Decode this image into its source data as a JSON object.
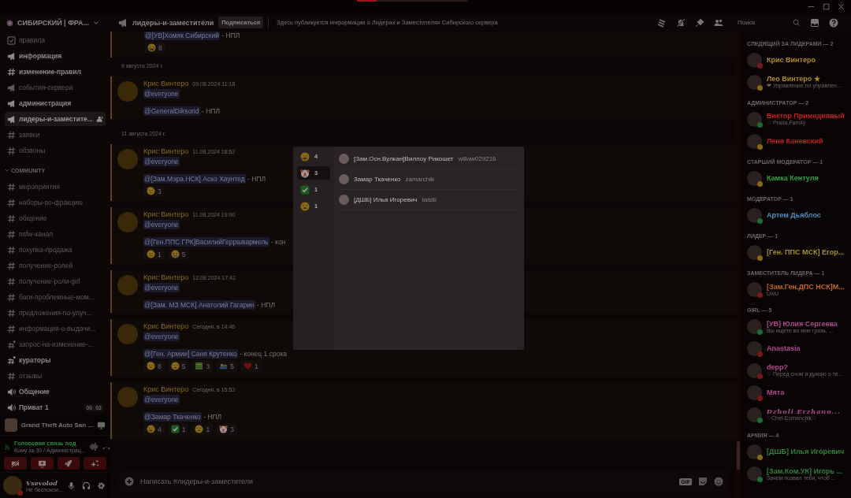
{
  "update_bar": {
    "level": 0.18
  },
  "server": {
    "name": "СИБИРСКИЙ | ФРА..."
  },
  "channels": [
    {
      "kind": "rules",
      "name": "правила",
      "unread": false,
      "selected": false
    },
    {
      "kind": "announce",
      "name": "информация",
      "unread": true,
      "selected": false
    },
    {
      "kind": "text",
      "name": "изменение-правил",
      "unread": true,
      "selected": false
    },
    {
      "kind": "announce",
      "name": "события-сервера",
      "unread": false,
      "selected": false
    },
    {
      "kind": "announce",
      "name": "администрация",
      "unread": true,
      "selected": false
    },
    {
      "kind": "announce",
      "name": "лидеры-и-заместите...",
      "unread": true,
      "selected": true
    },
    {
      "kind": "text",
      "name": "заявки",
      "unread": false,
      "selected": false
    },
    {
      "kind": "text",
      "name": "обзвоны",
      "unread": false,
      "selected": false
    },
    {
      "kind": "category",
      "name": "COMMUNITY",
      "expanded": true
    },
    {
      "kind": "text",
      "name": "мероприятия",
      "unread": false,
      "selected": false
    },
    {
      "kind": "text",
      "name": "наборы-во-фракцию",
      "unread": false,
      "selected": false
    },
    {
      "kind": "text",
      "name": "общение",
      "unread": false,
      "selected": false
    },
    {
      "kind": "text",
      "name": "nsfw-канал",
      "unread": false,
      "selected": false
    },
    {
      "kind": "text",
      "name": "покупка-продажа",
      "unread": false,
      "selected": false
    },
    {
      "kind": "text",
      "name": "получение-ролей",
      "unread": false,
      "selected": false
    },
    {
      "kind": "text",
      "name": "получение-роли-girl",
      "unread": false,
      "selected": false
    },
    {
      "kind": "text",
      "name": "баги-проблемные-мом...",
      "unread": false,
      "selected": false
    },
    {
      "kind": "text",
      "name": "предложения-по-улуч...",
      "unread": false,
      "selected": false
    },
    {
      "kind": "text",
      "name": "информация-о-выдачи...",
      "unread": false,
      "selected": false
    },
    {
      "kind": "thread",
      "name": "запрос-на-изменение-...",
      "unread": false,
      "selected": false
    },
    {
      "kind": "thread",
      "name": "кураторы",
      "unread": true,
      "selected": false
    },
    {
      "kind": "text",
      "name": "отзывы",
      "unread": false,
      "selected": false
    },
    {
      "kind": "voice",
      "name": "Общение",
      "unread": true,
      "selected": false
    },
    {
      "kind": "voice",
      "name": "Приват 1",
      "unread": true,
      "selected": false,
      "counters": [
        "00",
        "02"
      ]
    }
  ],
  "activity": {
    "title": "Grand Theft Auto San ..."
  },
  "voice": {
    "status": "Голосовая связь под",
    "channel": "Кому за 30 / Администрац..."
  },
  "user": {
    "name": "Vsevolod",
    "status_text": "Не беспокои...",
    "kind": "dnd"
  },
  "header": {
    "channel": "лидеры-и-заместители",
    "subscribe": "Подписаться",
    "topic": "Здесь публикуется информация о Лидерах и Заместителях Сибирского сервера",
    "search": {
      "placeholder": "Поиск"
    }
  },
  "messages": [
    {
      "kind": "continuation",
      "lines": [
        {
          "mention": "@[УВ]Хомяк Сибирский",
          "text": " - НПЛ"
        }
      ],
      "reactions": [
        {
          "kind": "joy",
          "count": "8"
        }
      ]
    },
    {
      "kind": "divider",
      "text": "9 августа 2024 г."
    },
    {
      "kind": "message",
      "author": "Крис Винтеро",
      "time": "09.08.2024 11:18",
      "everyone": "@everyone",
      "lines": [
        {
          "mention": "@GeneralDiksond",
          "text": " - НПЛ"
        }
      ]
    },
    {
      "kind": "divider",
      "text": "11 августа 2024 г."
    },
    {
      "kind": "message",
      "author": "Крис Винтеро",
      "time": "11.08.2024 18:52",
      "everyone": "@everyone",
      "lines": [
        {
          "mention": "@[Зам.Мэра.НСК] Аско Хаунтед",
          "text": " - НПЛ"
        }
      ],
      "reactions": [
        {
          "kind": "salute",
          "count": "3"
        }
      ]
    },
    {
      "kind": "message",
      "author": "Крис Винтеро",
      "time": "11.08.2024 19:00",
      "everyone": "@everyone",
      "lines": [
        {
          "mention": "@[Ген.ППС ГРК]ВасилийГерршвармель",
          "text": " - кон"
        }
      ],
      "reactions": [
        {
          "kind": "sad",
          "count": "1"
        },
        {
          "kind": "cry",
          "count": "5"
        }
      ]
    },
    {
      "kind": "message",
      "author": "Крис Винтеро",
      "time": "12.08.2024 17:42",
      "everyone": "@everyone",
      "lines": [
        {
          "mention": "@[Зам. МЗ МСК] Анатолий Гагарин",
          "text": " - НПЛ"
        }
      ]
    },
    {
      "kind": "message",
      "author": "Крис Винтеро",
      "time": "Сегодня, в 14:46",
      "everyone": "@everyone",
      "lines": [
        {
          "mention": "@[Ген. Армии] Саня Крутенко",
          "text": " - конец 1 срока"
        }
      ],
      "reactions": [
        {
          "kind": "salute",
          "count": "8"
        },
        {
          "kind": "weary",
          "count": "5"
        },
        {
          "kind": "sticker",
          "count": "3"
        },
        {
          "kind": "sleep",
          "count": "5"
        },
        {
          "kind": "heart",
          "count": "1"
        }
      ]
    },
    {
      "kind": "message",
      "author": "Крис Винтеро",
      "time": "Сегодня, в 15:53",
      "everyone": "@everyone",
      "lines": [
        {
          "mention": "@Замар Ткаченко",
          "text": " - НПЛ"
        }
      ],
      "reactions": [
        {
          "kind": "rofl",
          "count": "4"
        },
        {
          "kind": "check",
          "count": "1"
        },
        {
          "kind": "weary",
          "count": "1"
        },
        {
          "kind": "clown",
          "count": "3"
        }
      ]
    }
  ],
  "composer": {
    "placeholder": "Написать #лидеры-и-заместители",
    "gif": "GIF"
  },
  "members": [
    {
      "title": "СЛЕДЯЩИЙ ЗА ЛИДЕРАМИ — 2",
      "members": [
        {
          "name": "Крис Винтеро",
          "color": "#b08a20",
          "kind": "dnd",
          "fancy": false
        },
        {
          "name": "Лео Винтеро ★",
          "color": "#b08a20",
          "kind": "idle",
          "fancy": false,
          "subtitle": "❤ Управление по управлен..."
        }
      ]
    },
    {
      "title": "АДМИНИСТРАТОР — 2",
      "members": [
        {
          "name": "Виктор Примедиявый",
          "color": "#c02020",
          "kind": "online",
          "fancy": false,
          "subtitle": "♡ Prada Family"
        },
        {
          "name": "Леня Каневский",
          "color": "#c02020",
          "kind": "idle",
          "fancy": false
        }
      ]
    },
    {
      "title": "СТАРШИЙ МОДЕРАТОР — 1",
      "members": [
        {
          "name": "Камка Кентуля",
          "color": "#30a048",
          "kind": "idle",
          "fancy": false
        }
      ]
    },
    {
      "title": "МОДЕРАТОР — 1",
      "members": [
        {
          "name": "Артем Дьяблос",
          "color": "#4890c0",
          "kind": "online",
          "fancy": false
        }
      ]
    },
    {
      "title": "ЛИДЕР — 1",
      "members": [
        {
          "name": "[Ген. ППС МСК] Егор...",
          "color": "#a89020",
          "kind": "idle",
          "fancy": false
        }
      ]
    },
    {
      "title": "ЗАМЕСТИТЕЛЬ ЛИДЕРА — 1",
      "members": [
        {
          "name": "[Зам.Ген.ДПС НСК]М...",
          "color": "#c06818",
          "kind": "dnd",
          "fancy": false,
          "subtitle": "UwU"
        }
      ]
    },
    {
      "title": "GIRL — 5",
      "members": [
        {
          "name": "[УВ] Юлия Сергеева",
          "color": "#b04890",
          "kind": "online",
          "fancy": false,
          "subtitle": "Вы ищете во мне грязь, ..."
        },
        {
          "name": "Anastasia",
          "color": "#b04890",
          "kind": "dnd",
          "fancy": false
        },
        {
          "name": "depp?",
          "color": "#b04890",
          "kind": "dnd",
          "fancy": false,
          "subtitle": "♡ Перед сном я думаю о те..."
        },
        {
          "name": "Мята",
          "color": "#b04890",
          "kind": "dnd",
          "fancy": false
        },
        {
          "name": "Dzholi Erzhano...",
          "color": "#b04890",
          "kind": "online",
          "fancy": true,
          "subtitle": "♡Chel-Erzhanchik♡"
        }
      ]
    },
    {
      "title": "АРМИЯ — 4",
      "members": [
        {
          "name": "[ДШБ] Илья Игоревич",
          "color": "#30803a",
          "kind": "idle",
          "fancy": false
        },
        {
          "name": "[Зам.Ком.УК] Игорь ...",
          "color": "#30803a",
          "kind": "online",
          "fancy": false,
          "subtitle": "Зачем позвал тебя, чтоб ..."
        }
      ]
    }
  ],
  "reactions_popup": {
    "tabs": [
      {
        "kind": "rofl",
        "count": "4",
        "selected": false
      },
      {
        "kind": "clown",
        "count": "3",
        "selected": true
      },
      {
        "kind": "check",
        "count": "1",
        "selected": false
      },
      {
        "kind": "weary",
        "count": "1",
        "selected": false
      }
    ],
    "users": [
      {
        "name": "[Зам.Осн.Вулкан]Виллоу Рикошет",
        "username": "willow029216"
      },
      {
        "name": "Замар Ткаченко",
        "username": "zamarchik"
      },
      {
        "name": "[ДШБ] Илья Игоревич",
        "username": "taisiti"
      }
    ]
  }
}
